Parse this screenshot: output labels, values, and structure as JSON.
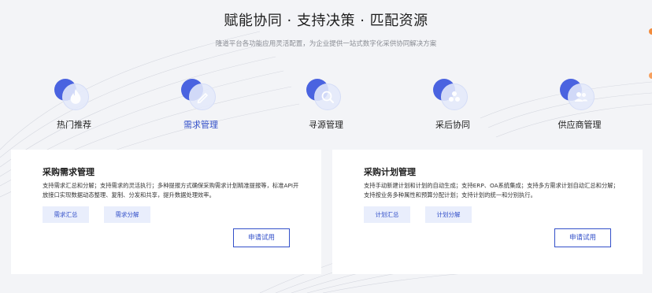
{
  "header": {
    "title": "赋能协同 · 支持决策 · 匹配资源",
    "subtitle": "隆道平台各功能应用灵活配置，为企业提供一站式数字化采供协同解决方案"
  },
  "tabs": [
    {
      "label": "热门推荐",
      "icon": "flame-icon",
      "active": false
    },
    {
      "label": "需求管理",
      "icon": "pencil-icon",
      "active": true
    },
    {
      "label": "寻源管理",
      "icon": "magnifier-icon",
      "active": false
    },
    {
      "label": "采后协同",
      "icon": "nodes-icon",
      "active": false
    },
    {
      "label": "供应商管理",
      "icon": "users-icon",
      "active": false
    }
  ],
  "cards": [
    {
      "title": "采购需求管理",
      "description": "支持需求汇总和分解；支持需求的灵活执行；多种提报方式确保采购需求计划精准提报等，标准API开放接口实现数据动态整理、复制、分发和共享，提升数据处理效率。",
      "tags": [
        "需求汇总",
        "需求分解"
      ],
      "button": "申请试用"
    },
    {
      "title": "采购计划管理",
      "description": "支持手动新建计划和计划的自动生成；支持ERP、OA系统集成；支持多方需求计划自动汇总和分解；支持按业务多种属性和预算分配计划；支持计划的统一和分别执行。",
      "tags": [
        "计划汇总",
        "计划分解"
      ],
      "button": "申请试用"
    }
  ],
  "colors": {
    "accent": "#3350c9",
    "icon_dot": "#4a63e0",
    "tag_bg": "#e9eefc",
    "page_bg": "#f3f4f7"
  }
}
